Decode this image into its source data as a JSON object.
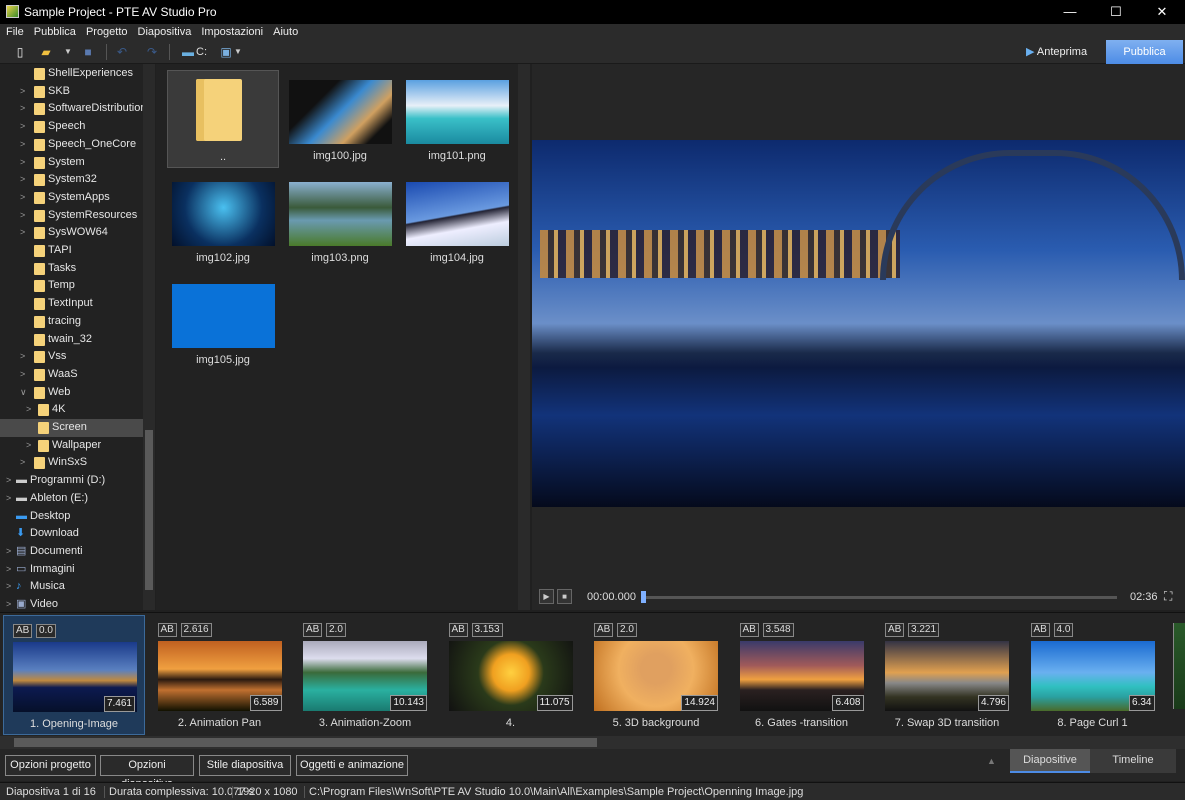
{
  "window": {
    "title": "Sample Project - PTE AV Studio Pro",
    "min": "—",
    "max": "☐",
    "close": "✕"
  },
  "menu": [
    "File",
    "Pubblica",
    "Progetto",
    "Diapositiva",
    "Impostazioni",
    "Aiuto"
  ],
  "toolbar": {
    "drive": "C:",
    "anteprima": "Anteprima",
    "pubblica": "Pubblica"
  },
  "tree": [
    {
      "label": "ShellExperiences",
      "level": 1,
      "arrow": false
    },
    {
      "label": "SKB",
      "level": 1,
      "arrow": true
    },
    {
      "label": "SoftwareDistribution",
      "level": 1,
      "arrow": true
    },
    {
      "label": "Speech",
      "level": 1,
      "arrow": true
    },
    {
      "label": "Speech_OneCore",
      "level": 1,
      "arrow": true
    },
    {
      "label": "System",
      "level": 1,
      "arrow": true
    },
    {
      "label": "System32",
      "level": 1,
      "arrow": true
    },
    {
      "label": "SystemApps",
      "level": 1,
      "arrow": true
    },
    {
      "label": "SystemResources",
      "level": 1,
      "arrow": true
    },
    {
      "label": "SysWOW64",
      "level": 1,
      "arrow": true
    },
    {
      "label": "TAPI",
      "level": 1,
      "arrow": false
    },
    {
      "label": "Tasks",
      "level": 1,
      "arrow": false
    },
    {
      "label": "Temp",
      "level": 1,
      "arrow": false
    },
    {
      "label": "TextInput",
      "level": 1,
      "arrow": false
    },
    {
      "label": "tracing",
      "level": 1,
      "arrow": false
    },
    {
      "label": "twain_32",
      "level": 1,
      "arrow": false
    },
    {
      "label": "Vss",
      "level": 1,
      "arrow": true
    },
    {
      "label": "WaaS",
      "level": 1,
      "arrow": true
    },
    {
      "label": "Web",
      "level": 1,
      "arrow": true,
      "expanded": true
    },
    {
      "label": "4K",
      "level": 2,
      "arrow": true
    },
    {
      "label": "Screen",
      "level": 2,
      "arrow": false,
      "selected": true
    },
    {
      "label": "Wallpaper",
      "level": 2,
      "arrow": true
    },
    {
      "label": "WinSxS",
      "level": 1,
      "arrow": true
    },
    {
      "label": "Programmi (D:)",
      "level": 0,
      "arrow": true,
      "icon": "drive"
    },
    {
      "label": "Ableton (E:)",
      "level": 0,
      "arrow": true,
      "icon": "drive"
    },
    {
      "label": "Desktop",
      "level": 0,
      "arrow": false,
      "icon": "desktop"
    },
    {
      "label": "Download",
      "level": 0,
      "arrow": false,
      "icon": "download"
    },
    {
      "label": "Documenti",
      "level": 0,
      "arrow": true,
      "icon": "documents"
    },
    {
      "label": "Immagini",
      "level": 0,
      "arrow": true,
      "icon": "pictures"
    },
    {
      "label": "Musica",
      "level": 0,
      "arrow": true,
      "icon": "music"
    },
    {
      "label": "Video",
      "level": 0,
      "arrow": true,
      "icon": "video"
    }
  ],
  "files": [
    {
      "name": "..",
      "type": "folder"
    },
    {
      "name": "img100.jpg",
      "bg": "linear-gradient(135deg,#111 30%,#3a8ad0 50%,#d0a060 70%,#111 85%)"
    },
    {
      "name": "img101.png",
      "bg": "linear-gradient(180deg,#5aa0e0 0%,#e8f0f8 40%,#3ac0c8 60%,#1a8aa0 100%)"
    },
    {
      "name": "img102.jpg",
      "bg": "radial-gradient(circle at 50% 40%,#4ac0f0,#0a3060 60%,#02102a)"
    },
    {
      "name": "img103.png",
      "bg": "linear-gradient(180deg,#8ab0d0 0%,#3a5a3a 40%,#6a9ab0 60%,#4a7a2a 100%)"
    },
    {
      "name": "img104.jpg",
      "bg": "linear-gradient(170deg,#1a4ab0 0%,#6a9ae0 50%,#223 52%,#eef 70%,#bcd 100%)"
    },
    {
      "name": "img105.jpg",
      "bg": "#0a72d8"
    }
  ],
  "player": {
    "time": "00:00.000",
    "total": "02:36"
  },
  "slides": [
    {
      "name": "1. Opening-Image",
      "ab": "AB",
      "trans": "0.0",
      "dur": "7.461",
      "bg": "linear-gradient(180deg,#1a3a8a 0%,#5a80c0 40%,#c08a40 55%,#0c1a50 65%,#06102a 100%)"
    },
    {
      "name": "2. Animation Pan",
      "ab": "AB",
      "trans": "2.616",
      "dur": "6.589",
      "bg": "linear-gradient(180deg,#c06020 0%,#f0a040 40%,#2a1a10 55%,#c07030 70%,#110 100%)"
    },
    {
      "name": "3. Animation-Zoom",
      "ab": "AB",
      "trans": "2.0",
      "dur": "10.143",
      "bg": "linear-gradient(180deg,#aab 0%,#dde 25%,#3a6a3a 45%,#2ab0a0 70%,#1a7a70 100%)"
    },
    {
      "name": "4.",
      "ab": "AB",
      "trans": "3.153",
      "dur": "11.075",
      "bg": "radial-gradient(circle at 50% 45%,#ffd040 0%,#f0a020 25%,#2a3a1a 45%,#111 100%)"
    },
    {
      "name": "5. 3D background",
      "ab": "AB",
      "trans": "2.0",
      "dur": "14.924",
      "bg": "radial-gradient(circle at 50% 40%,#e0a060 20%,#f0b060 50%,#c07020 100%)"
    },
    {
      "name": "6. Gates -transition",
      "ab": "AB",
      "trans": "3.548",
      "dur": "6.408",
      "bg": "linear-gradient(180deg,#3a3a6a 0%,#a05a5a 35%,#f0a040 55%,#2a2020 70%,#111 100%)"
    },
    {
      "name": "7. Swap 3D transition",
      "ab": "AB",
      "trans": "3.221",
      "dur": "4.796",
      "bg": "linear-gradient(180deg,#334 0%,#e0a050 45%,#888 60%,#332 80%,#111 100%)"
    },
    {
      "name": "8. Page Curl 1",
      "ab": "AB",
      "trans": "4.0",
      "dur": "6.34",
      "bg": "linear-gradient(180deg,#1a6ad0 0%,#6ab0f0 45%,#30c0c0 65%,#2aa0a0 80%,#4a6a2a 100%)"
    }
  ],
  "buttons": [
    "Opzioni progetto",
    "Opzioni diapositiva",
    "Stile diapositiva",
    "Oggetti e animazione"
  ],
  "tabs": {
    "slides": "Diapositive",
    "timeline": "Timeline"
  },
  "status": {
    "slide": "Diapositiva 1 di 16",
    "duration": "Durata complessiva: 10.077 s",
    "resolution": "1920 x 1080",
    "path": "C:\\Program Files\\WnSoft\\PTE AV Studio 10.0\\Main\\All\\Examples\\Sample Project\\Openning Image.jpg"
  },
  "colors": {
    "accent": "#4d8ce6",
    "folder": "#f5d27a"
  }
}
